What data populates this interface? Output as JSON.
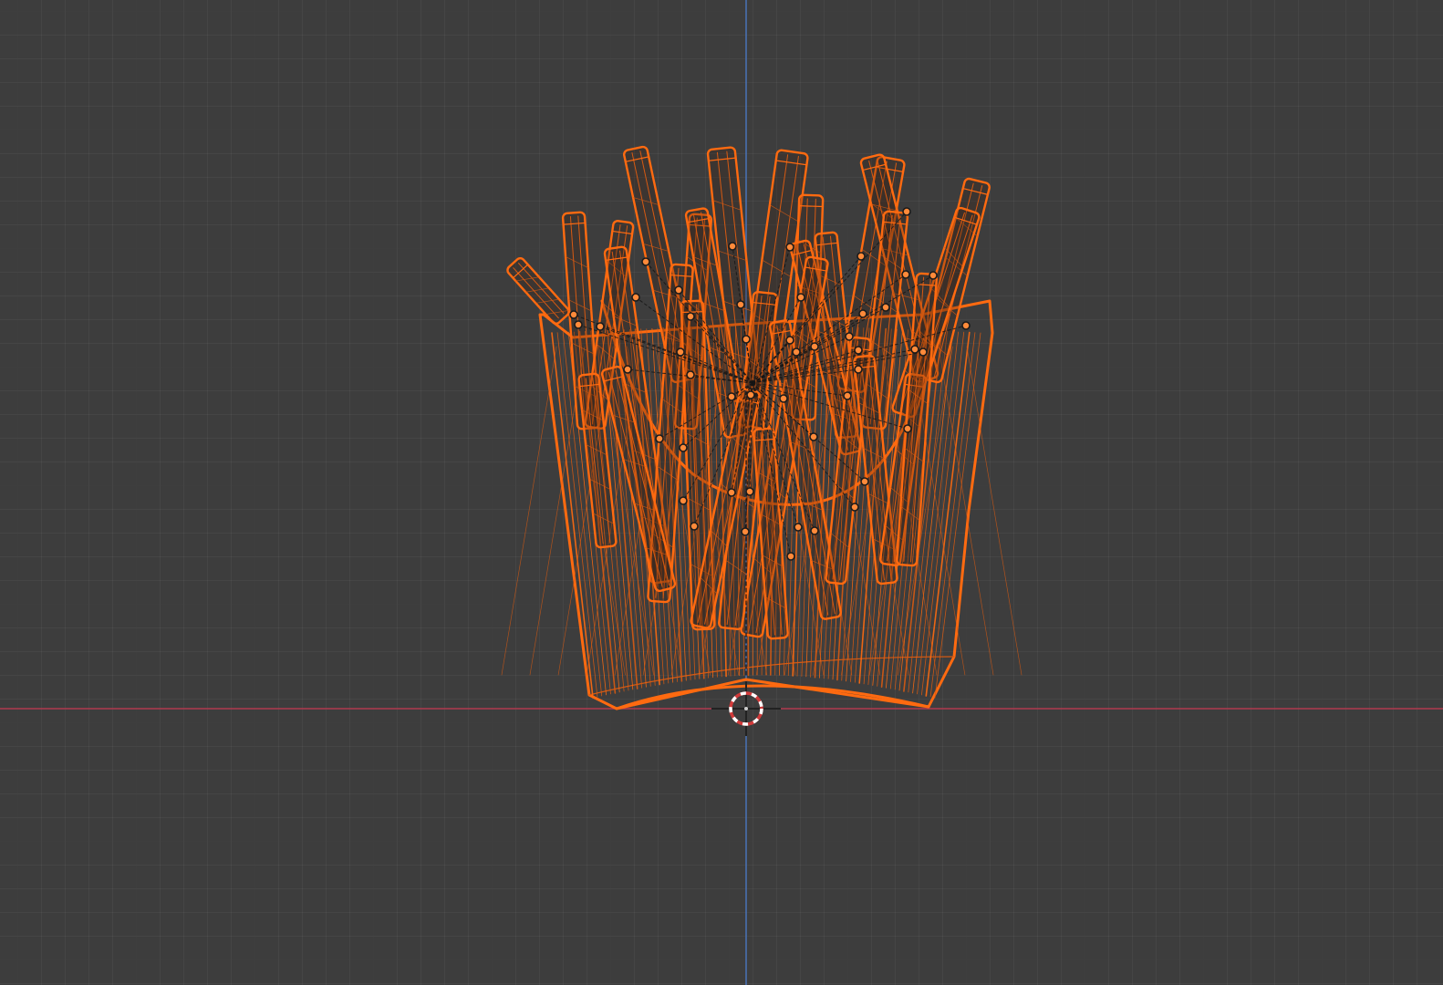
{
  "viewport": {
    "background": "#3d3d3d",
    "grid_minor": "#474747",
    "grid_major": "#363636"
  },
  "axes": {
    "x_axis_color": "#b03a4f",
    "z_axis_color": "#4a73b8"
  },
  "object": {
    "name": "french-fries",
    "wire_color": "#ff6a10",
    "wire_dim": "#d75a12",
    "display": "wireframe",
    "selected": true
  },
  "cursor": {
    "icon": "3d-cursor-icon",
    "ring_color": "#d23a3a",
    "dash_color": "#ffffff"
  }
}
